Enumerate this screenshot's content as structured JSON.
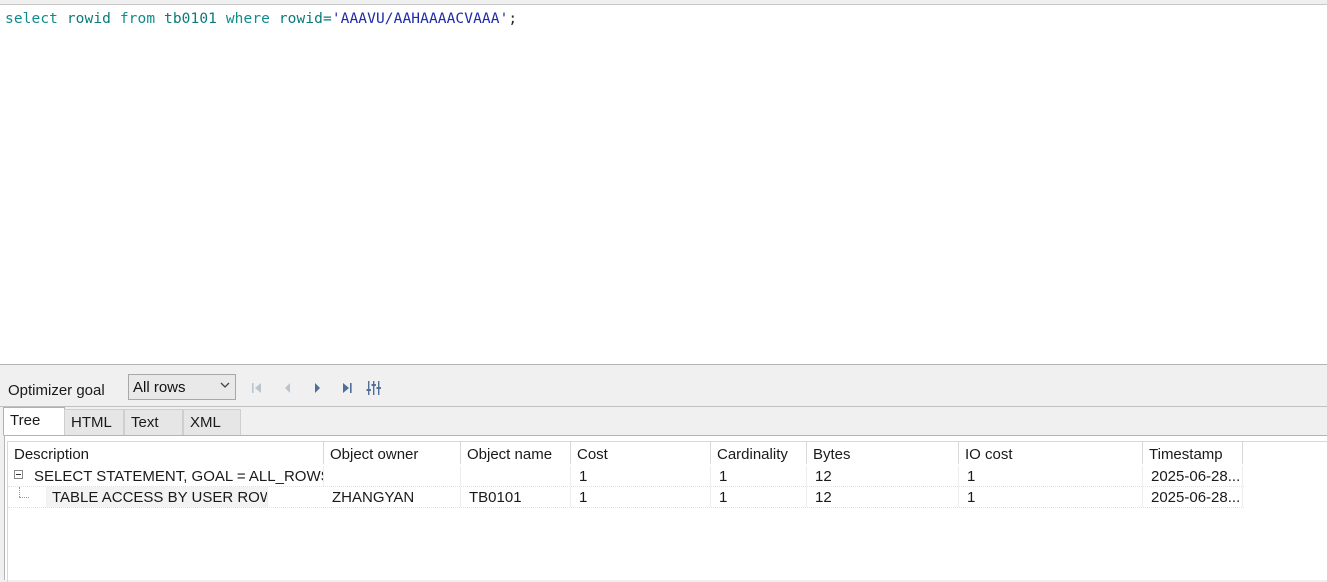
{
  "editor": {
    "sql": {
      "t1": "select",
      "t2": "rowid",
      "t3": "from",
      "t4": "tb0101",
      "t5": "where",
      "t6": "rowid=",
      "t7": "'AAAVU/AAHAAAACVAAA'",
      "t8": ";"
    }
  },
  "toolbar": {
    "optimizer_label": "Optimizer goal",
    "optimizer_value": "All rows",
    "icons": [
      "first-icon",
      "previous-icon",
      "next-icon",
      "last-icon",
      "settings-sliders-icon"
    ]
  },
  "tabs": [
    {
      "label": "Tree",
      "active": true
    },
    {
      "label": "HTML",
      "active": false
    },
    {
      "label": "Text",
      "active": false
    },
    {
      "label": "XML",
      "active": false
    }
  ],
  "grid": {
    "columns": [
      "Description",
      "Object owner",
      "Object name",
      "Cost",
      "Cardinality",
      "Bytes",
      "IO cost",
      "Timestamp"
    ],
    "rows": [
      {
        "description": "SELECT STATEMENT, GOAL = ALL_ROWS",
        "owner": "",
        "name": "",
        "cost": "1",
        "cardinality": "1",
        "bytes": "12",
        "io_cost": "1",
        "timestamp": "2025-06-28..."
      },
      {
        "description": "TABLE ACCESS BY USER ROWID",
        "owner": "ZHANGYAN",
        "name": "TB0101",
        "cost": "1",
        "cardinality": "1",
        "bytes": "12",
        "io_cost": "1",
        "timestamp": "2025-06-28..."
      }
    ]
  }
}
